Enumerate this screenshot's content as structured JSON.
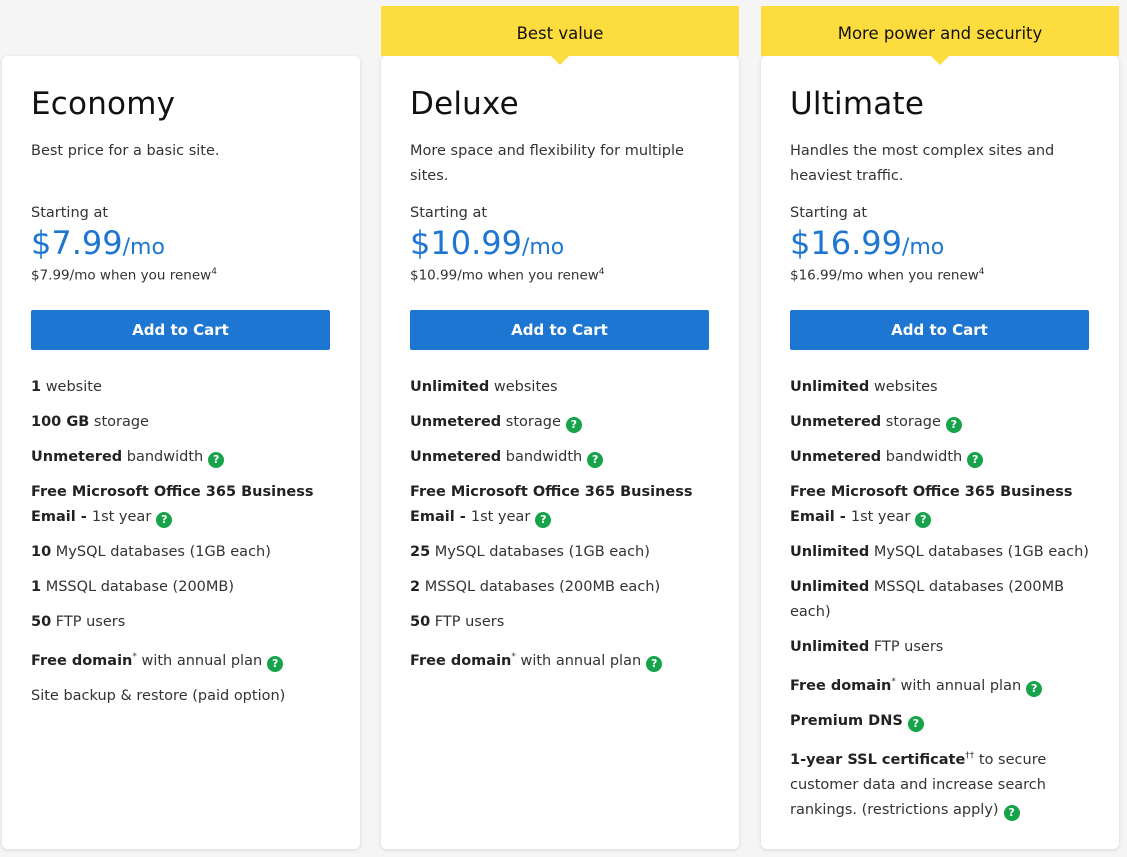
{
  "plans": [
    {
      "banner": "",
      "name": "Economy",
      "description": "Best price for a basic site.",
      "starting_label": "Starting at",
      "price": "$7.99",
      "unit": "/mo",
      "renew_text": "$7.99/mo when you renew",
      "renew_sup": "4",
      "button_label": "Add to Cart",
      "features": [
        {
          "bold": "1",
          "text": " website"
        },
        {
          "bold": "100 GB",
          "text": " storage"
        },
        {
          "bold": "Unmetered",
          "text": " bandwidth",
          "help": true
        },
        {
          "bold": "Free Microsoft Office 365 Business Email - ",
          "text": "1st year",
          "help": true
        },
        {
          "bold": "10",
          "text": " MySQL databases (1GB each)"
        },
        {
          "bold": "1",
          "text": " MSSQL database (200MB)"
        },
        {
          "bold": "50",
          "text": " FTP users"
        },
        {
          "bold": "Free domain",
          "sup": "*",
          "text": " with annual plan",
          "help": true
        },
        {
          "bold": "",
          "text": "Site backup & restore (paid option)"
        }
      ]
    },
    {
      "banner": "Best value",
      "name": "Deluxe",
      "description": "More space and flexibility for multiple sites.",
      "starting_label": "Starting at",
      "price": "$10.99",
      "unit": "/mo",
      "renew_text": "$10.99/mo when you renew",
      "renew_sup": "4",
      "button_label": "Add to Cart",
      "features": [
        {
          "bold": "Unlimited",
          "text": " websites"
        },
        {
          "bold": "Unmetered",
          "text": " storage",
          "help": true
        },
        {
          "bold": "Unmetered",
          "text": " bandwidth",
          "help": true
        },
        {
          "bold": "Free Microsoft Office 365 Business Email - ",
          "text": "1st year",
          "help": true
        },
        {
          "bold": "25",
          "text": " MySQL databases (1GB each)"
        },
        {
          "bold": "2",
          "text": " MSSQL databases (200MB each)"
        },
        {
          "bold": "50",
          "text": " FTP users"
        },
        {
          "bold": "Free domain",
          "sup": "*",
          "text": " with annual plan",
          "help": true
        }
      ]
    },
    {
      "banner": "More power and security",
      "name": "Ultimate",
      "description": "Handles the most complex sites and heaviest traffic.",
      "starting_label": "Starting at",
      "price": "$16.99",
      "unit": "/mo",
      "renew_text": "$16.99/mo when you renew",
      "renew_sup": "4",
      "button_label": "Add to Cart",
      "features": [
        {
          "bold": "Unlimited",
          "text": " websites"
        },
        {
          "bold": "Unmetered",
          "text": " storage",
          "help": true
        },
        {
          "bold": "Unmetered",
          "text": " bandwidth",
          "help": true
        },
        {
          "bold": "Free Microsoft Office 365 Business Email - ",
          "text": "1st year",
          "help": true
        },
        {
          "bold": "Unlimited",
          "text": " MySQL databases (1GB each)"
        },
        {
          "bold": "Unlimited",
          "text": " MSSQL databases (200MB each)"
        },
        {
          "bold": "Unlimited",
          "text": " FTP users"
        },
        {
          "bold": "Free domain",
          "sup": "*",
          "text": " with annual plan",
          "help": true
        },
        {
          "bold": "Premium DNS",
          "text": "",
          "help": true
        },
        {
          "bold": "1-year SSL certificate",
          "sup": "††",
          "text": " to secure customer data and increase search rankings. (restrictions apply)",
          "help": true
        }
      ]
    }
  ],
  "help_icon_glyph": "?",
  "colors": {
    "accent": "#1d76d1",
    "banner": "#fddc3e",
    "help_icon": "#16a34a"
  }
}
